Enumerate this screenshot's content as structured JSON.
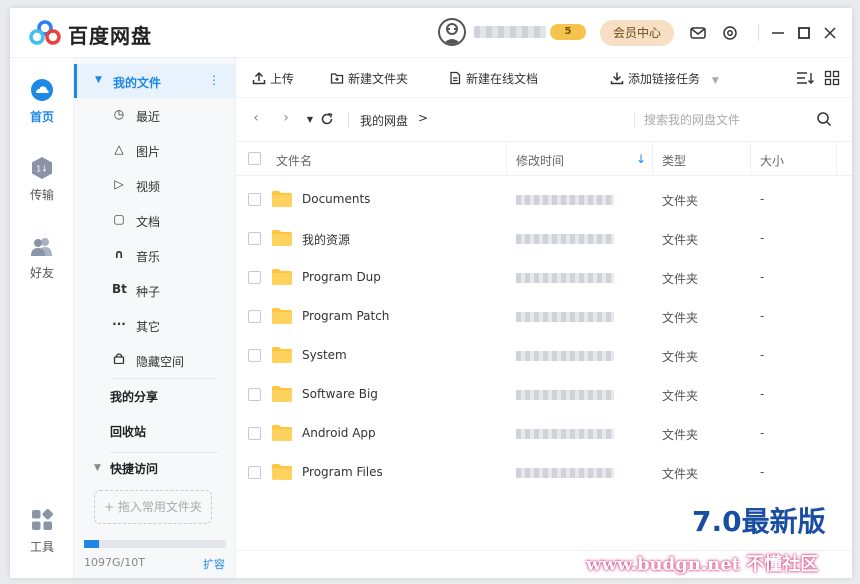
{
  "app": {
    "title": "百度网盘",
    "vip_level": "5"
  },
  "titlebar": {
    "member_center": "会员中心"
  },
  "leftnav": [
    {
      "label": "首页",
      "icon": "cloud-icon",
      "active": true
    },
    {
      "label": "传输",
      "icon": "transfer-icon",
      "active": false
    },
    {
      "label": "好友",
      "icon": "friends-icon",
      "active": false
    },
    {
      "label": "工具",
      "icon": "tools-icon",
      "active": false
    }
  ],
  "sidebar": {
    "my_files": "我的文件",
    "items": [
      {
        "label": "最近",
        "icon": "clock-icon",
        "glyph": "◷"
      },
      {
        "label": "图片",
        "icon": "image-icon",
        "glyph": "△"
      },
      {
        "label": "视频",
        "icon": "video-icon",
        "glyph": "▷"
      },
      {
        "label": "文档",
        "icon": "document-icon",
        "glyph": "▢"
      },
      {
        "label": "音乐",
        "icon": "headphones-icon",
        "glyph": "∩"
      },
      {
        "label": "种子",
        "icon": "torrent-icon",
        "glyph": "Bt"
      },
      {
        "label": "其它",
        "icon": "more-icon",
        "glyph": "···"
      },
      {
        "label": "隐藏空间",
        "icon": "lock-icon",
        "glyph": "🔒"
      }
    ],
    "my_share": "我的分享",
    "recycle_bin": "回收站",
    "quick_access": "快捷访问",
    "add_common_folder": "+ 拖入常用文件夹",
    "quota_text": "1097G/10T",
    "quota_fraction": 0.107,
    "expand": "扩容"
  },
  "toolbar": {
    "upload": "上传",
    "new_folder": "新建文件夹",
    "new_online_doc": "新建在线文档",
    "add_link_task": "添加链接任务"
  },
  "navbar": {
    "breadcrumb_root": "我的网盘",
    "breadcrumb_sep": ">",
    "search_placeholder": "搜索我的网盘文件"
  },
  "table": {
    "columns": {
      "name": "文件名",
      "modified": "修改时间",
      "type": "类型",
      "size": "大小"
    },
    "rows": [
      {
        "name": "Documents",
        "type": "文件夹",
        "size": "-"
      },
      {
        "name": "我的资源",
        "type": "文件夹",
        "size": "-"
      },
      {
        "name": "Program Dup",
        "type": "文件夹",
        "size": "-"
      },
      {
        "name": "Program Patch",
        "type": "文件夹",
        "size": "-"
      },
      {
        "name": "System",
        "type": "文件夹",
        "size": "-"
      },
      {
        "name": "Software Big",
        "type": "文件夹",
        "size": "-"
      },
      {
        "name": "Android App",
        "type": "文件夹",
        "size": "-"
      },
      {
        "name": "Program Files",
        "type": "文件夹",
        "size": "-"
      }
    ]
  },
  "watermark": {
    "version": "7.0最新版",
    "site": "www.budgn.net 不懂社区"
  },
  "colors": {
    "accent": "#1e88e5",
    "folder": "#ffc53d",
    "member": "#f6dfc2"
  }
}
